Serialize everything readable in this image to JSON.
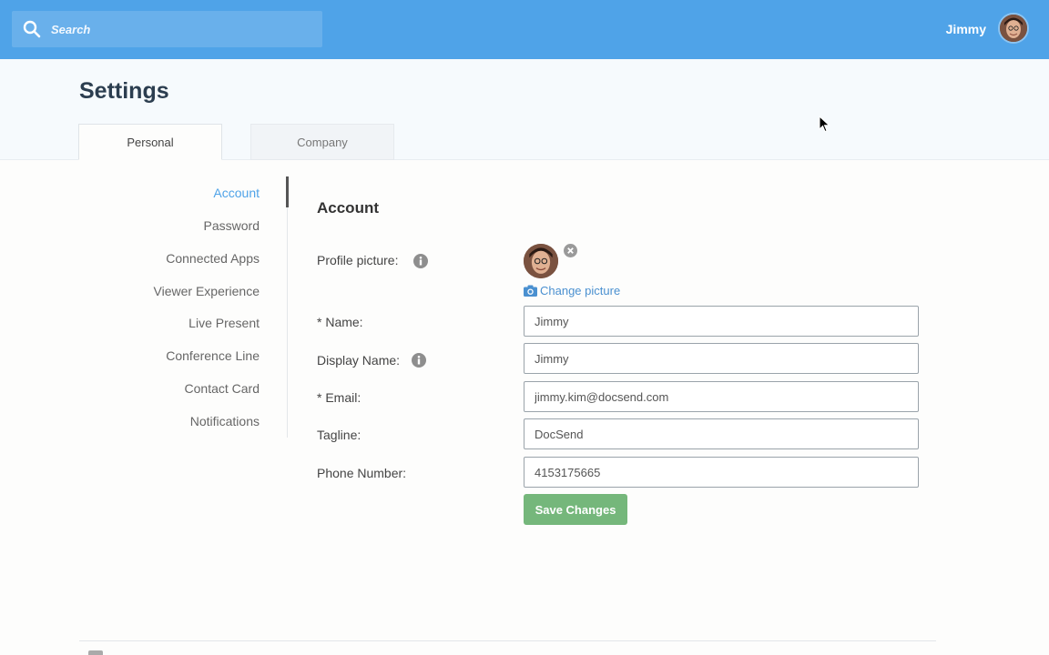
{
  "topbar": {
    "search_placeholder": "Search",
    "user_name": "Jimmy",
    "accent_color": "#4fa3e8"
  },
  "page": {
    "title": "Settings"
  },
  "tabs": [
    {
      "label": "Personal",
      "active": true
    },
    {
      "label": "Company",
      "active": false
    }
  ],
  "sidenav": {
    "items": [
      {
        "label": "Account",
        "active": true
      },
      {
        "label": "Password",
        "active": false
      },
      {
        "label": "Connected Apps",
        "active": false
      },
      {
        "label": "Viewer Experience",
        "active": false
      },
      {
        "label": "Live Present",
        "active": false
      },
      {
        "label": "Conference Line",
        "active": false
      },
      {
        "label": "Contact Card",
        "active": false
      },
      {
        "label": "Notifications",
        "active": false
      }
    ]
  },
  "account": {
    "section_title": "Account",
    "profile_picture_label": "Profile picture:",
    "change_picture_label": "Change picture",
    "name_label": "* Name:",
    "name_value": "Jimmy",
    "display_name_label": "Display Name:",
    "display_name_value": "Jimmy",
    "email_label": "* Email:",
    "email_value": "jimmy.kim@docsend.com",
    "tagline_label": "Tagline:",
    "tagline_value": "DocSend",
    "phone_label": "Phone Number:",
    "phone_value": "4153175665",
    "save_label": "Save Changes",
    "save_color": "#75b77b"
  },
  "icons": {
    "search": "search-icon",
    "info": "info-icon",
    "remove": "close-circle-icon",
    "camera": "camera-icon"
  }
}
